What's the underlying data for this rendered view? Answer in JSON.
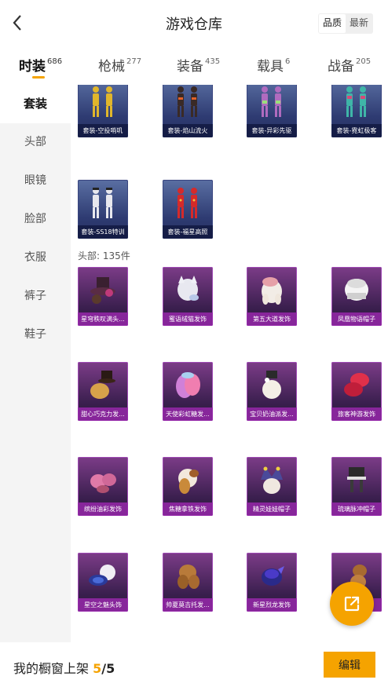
{
  "header": {
    "title": "游戏仓库",
    "back_icon": "chevron-left-icon",
    "sort_options": [
      "品质",
      "最新"
    ],
    "sort_selected": "品质"
  },
  "tabs": [
    {
      "label": "时装",
      "count": "686",
      "active": true
    },
    {
      "label": "枪械",
      "count": "277",
      "active": false
    },
    {
      "label": "装备",
      "count": "435",
      "active": false
    },
    {
      "label": "载具",
      "count": "6",
      "active": false
    },
    {
      "label": "战备",
      "count": "205",
      "active": false
    }
  ],
  "sidebar": {
    "items": [
      {
        "label": "套装",
        "active": true
      },
      {
        "label": "头部",
        "active": false
      },
      {
        "label": "眼镜",
        "active": false
      },
      {
        "label": "脸部",
        "active": false
      },
      {
        "label": "衣服",
        "active": false
      },
      {
        "label": "裤子",
        "active": false
      },
      {
        "label": "鞋子",
        "active": false
      }
    ]
  },
  "suits": {
    "items": [
      {
        "name": "套装-空投哨叽"
      },
      {
        "name": "套装-焰山流火"
      },
      {
        "name": "套装-异彩先驱"
      },
      {
        "name": "套装-霓虹极客"
      },
      {
        "name": "套装-SS18特训"
      },
      {
        "name": "套装-福星高照"
      }
    ]
  },
  "head_section": {
    "label": "头部: 135件",
    "items": [
      {
        "name": "星穹秩叹满头..."
      },
      {
        "name": "蜜语绒猫发饰"
      },
      {
        "name": "第五大道发饰"
      },
      {
        "name": "凤凰物语帽子"
      },
      {
        "name": "甜心巧克力发..."
      },
      {
        "name": "天使彩虹糖发..."
      },
      {
        "name": "宝贝奶油派发..."
      },
      {
        "name": "旅客神游发饰"
      },
      {
        "name": "缤纷油彩发饰"
      },
      {
        "name": "焦糖拿铁发饰"
      },
      {
        "name": "精灵娃娃帽子"
      },
      {
        "name": "琉璃脉冲帽子"
      },
      {
        "name": "星空之魅头饰"
      },
      {
        "name": "帅夏莫吉托发..."
      },
      {
        "name": "新星烈龙发饰"
      },
      {
        "name": ""
      }
    ]
  },
  "footer": {
    "label": "我的橱窗上架",
    "current": "5",
    "total": "/5",
    "edit_label": "编辑"
  },
  "fab": {
    "icon": "share-external-icon"
  },
  "colors": {
    "accent": "#f5a300",
    "suit_card": "#2e3b72",
    "head_card": "#7c3c88"
  }
}
